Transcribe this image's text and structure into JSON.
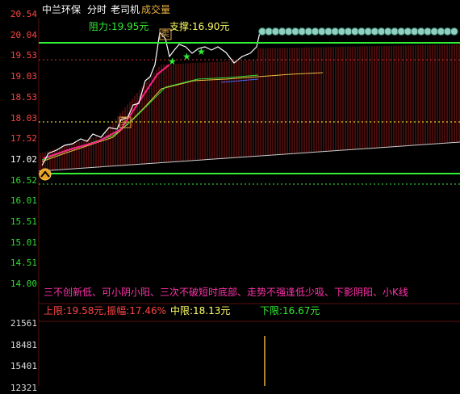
{
  "header": {
    "stock_name": "中兰环保",
    "period": "分时",
    "indicator": "老司机",
    "volume_label": "成交量"
  },
  "price_axis": {
    "labels": [
      "20.54",
      "20.04",
      "19.53",
      "19.03",
      "18.53",
      "18.03",
      "17.52",
      "17.02",
      "16.52",
      "16.01",
      "15.51",
      "15.01",
      "14.51",
      "14.00"
    ],
    "colors": {
      "up": "#ff4444",
      "base": "#ffffff",
      "down": "#33dd33"
    }
  },
  "volume_axis": {
    "labels": [
      "21561",
      "18481",
      "15401",
      "12321"
    ]
  },
  "annotations": {
    "resistance": "阻力:19.95元",
    "support": "支撑:16.90元",
    "note": "三不创新低、可小阴小阳、三次不破短时底部、走势不强逢低少吸、下影阴阳、小K线",
    "upper_limit": "上限:19.58元,振幅:17.46%",
    "mid_limit": "中限:18.13元",
    "lower_limit": "下限:16.67元",
    "sell_marker": "卖",
    "buy_marker": "买",
    "star_marker": "★"
  },
  "colors": {
    "price_line": "#ffffff",
    "avg_line": "#ff2288",
    "resistance_line": "#33ee33",
    "support_line": "#33ee33",
    "mid_dashed": "#ffff33",
    "red_bars": "#8a1818",
    "note_text": "#ff33aa",
    "upper_text": "#ff4444",
    "mid_text": "#ffff66",
    "lower_text": "#33ee33",
    "circle_row": "#8fd0c0"
  }
}
